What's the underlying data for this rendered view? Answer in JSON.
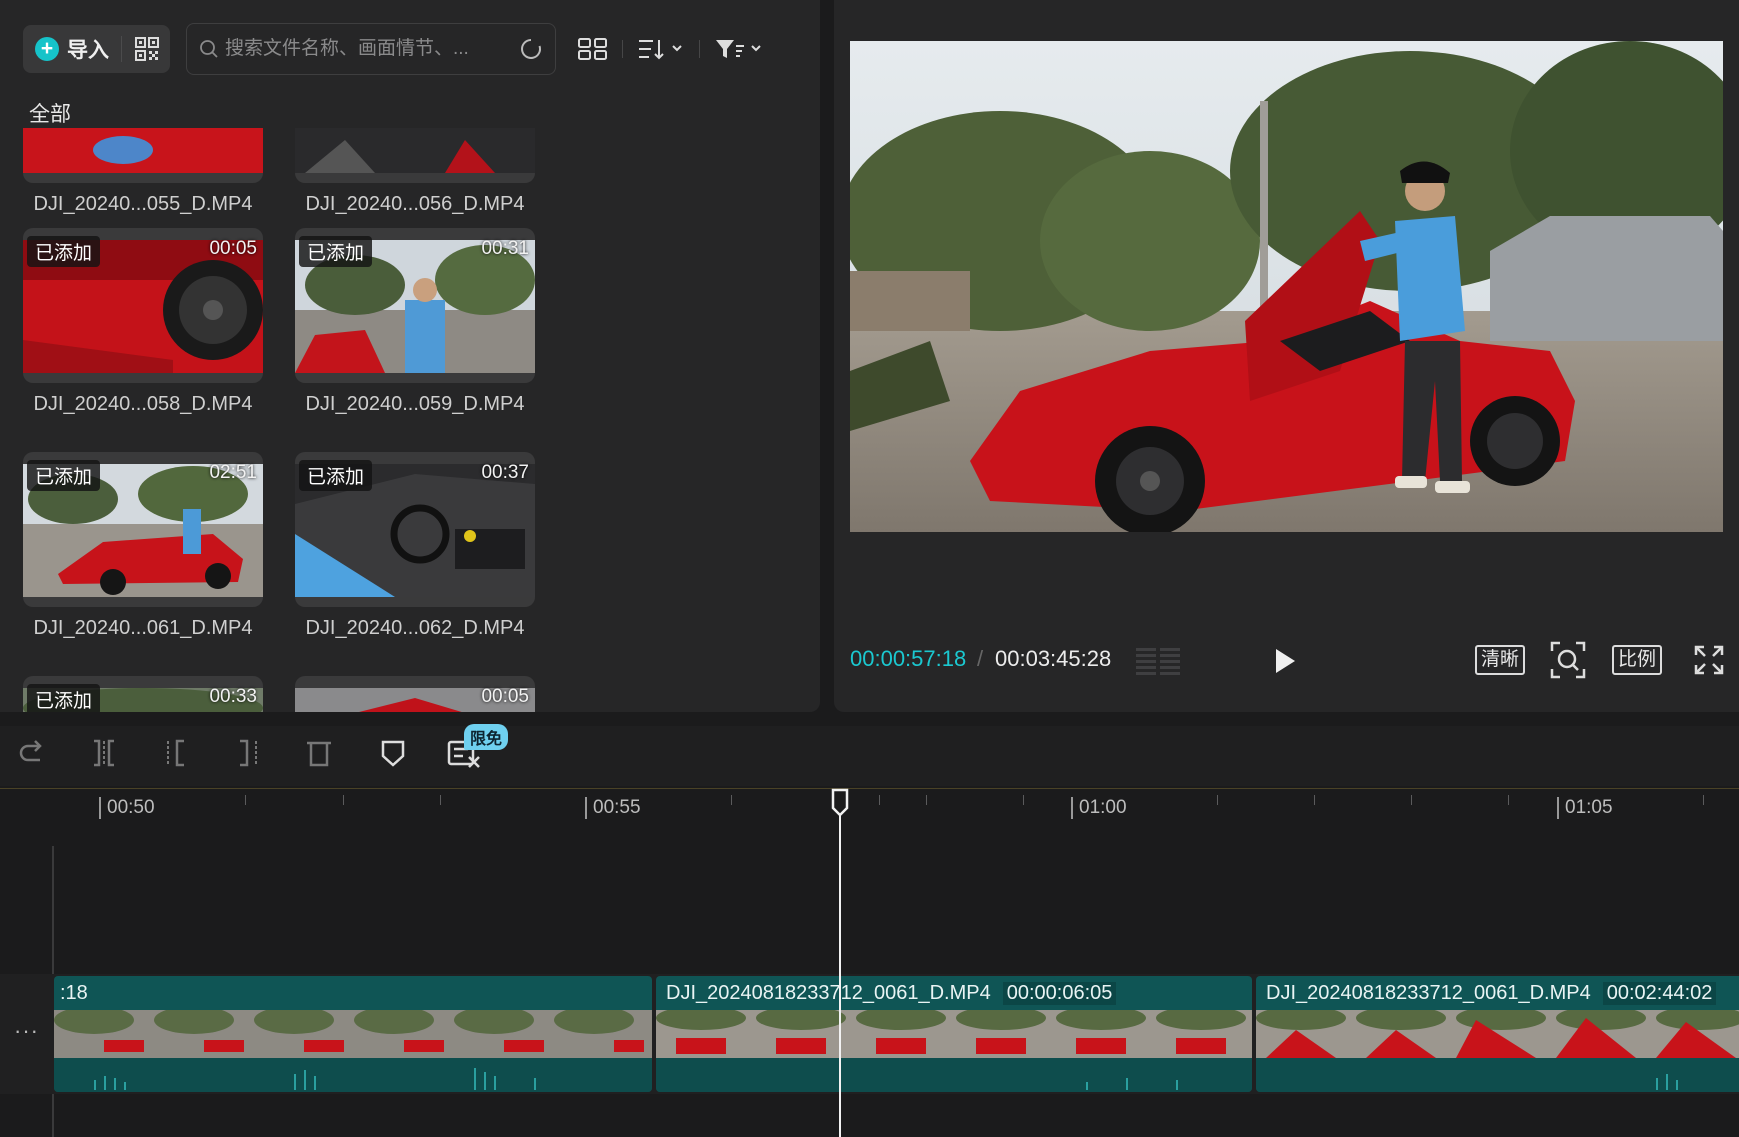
{
  "media": {
    "import_label": "导入",
    "search_placeholder": "搜索文件名称、画面情节、...",
    "section_label": "全部",
    "items": [
      {
        "name": "DJI_20240...055_D.MP4",
        "added": "",
        "duration": ""
      },
      {
        "name": "DJI_20240...056_D.MP4",
        "added": "",
        "duration": ""
      },
      {
        "name": "DJI_20240...058_D.MP4",
        "added": "已添加",
        "duration": "00:05"
      },
      {
        "name": "DJI_20240...059_D.MP4",
        "added": "已添加",
        "duration": "00:31"
      },
      {
        "name": "DJI_20240...061_D.MP4",
        "added": "已添加",
        "duration": "02:51"
      },
      {
        "name": "DJI_20240...062_D.MP4",
        "added": "已添加",
        "duration": "00:37"
      },
      {
        "name": "",
        "added": "已添加",
        "duration": "00:33"
      },
      {
        "name": "",
        "added": "",
        "duration": "00:05"
      }
    ]
  },
  "player": {
    "current_time": "00:00:57:18",
    "separator": "/",
    "total_time": "00:03:45:28",
    "quality_label": "清晰",
    "ratio_label": "比例"
  },
  "timeline": {
    "free_badge": "限免",
    "ruler_labels": [
      "00:50",
      "00:55",
      "01:00",
      "01:05"
    ],
    "clips": [
      {
        "title": ":18",
        "duration": ""
      },
      {
        "title": "DJI_20240818233712_0061_D.MP4",
        "duration": "00:00:06:05"
      },
      {
        "title": "DJI_20240818233712_0061_D.MP4",
        "duration": "00:02:44:02"
      }
    ]
  },
  "colors": {
    "accent": "#1bc8d0",
    "clip": "#0f5555",
    "panel": "#262627",
    "background": "#1b1b1c"
  }
}
